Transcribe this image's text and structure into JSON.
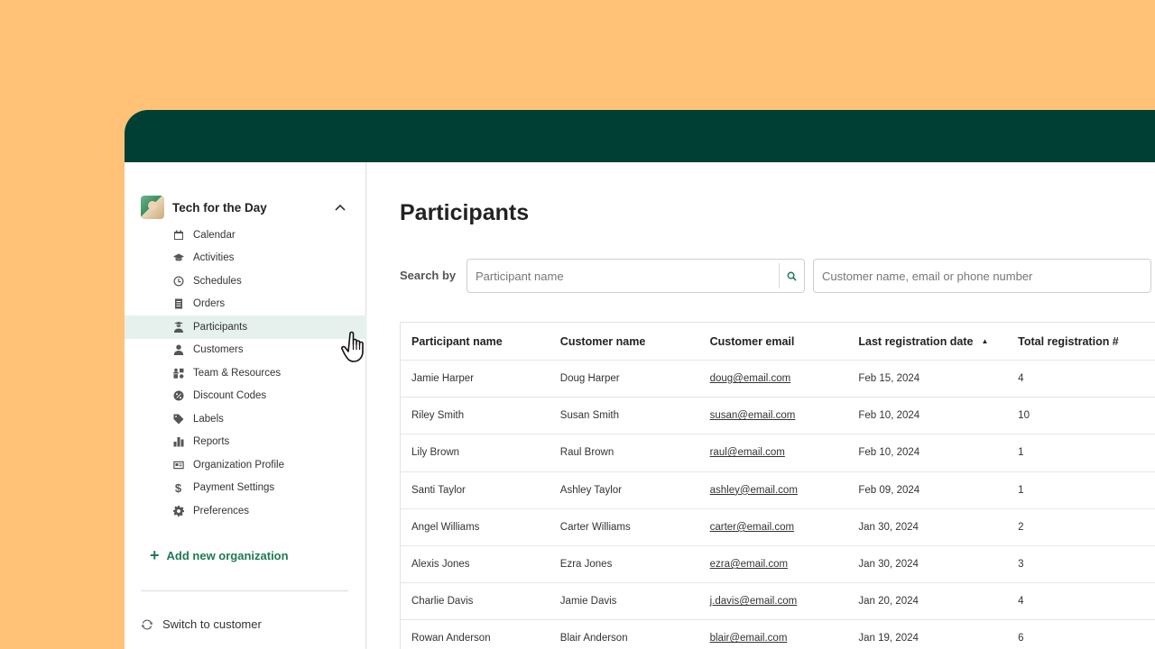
{
  "sidebar": {
    "org_name": "Tech for the Day",
    "items": [
      {
        "label": "Calendar",
        "icon": "calendar-icon"
      },
      {
        "label": "Activities",
        "icon": "graduation-cap-icon"
      },
      {
        "label": "Schedules",
        "icon": "clock-icon"
      },
      {
        "label": "Orders",
        "icon": "document-icon"
      },
      {
        "label": "Participants",
        "icon": "participant-icon",
        "active": true
      },
      {
        "label": "Customers",
        "icon": "person-icon"
      },
      {
        "label": "Team & Resources",
        "icon": "team-icon"
      },
      {
        "label": "Discount Codes",
        "icon": "discount-icon"
      },
      {
        "label": "Labels",
        "icon": "tag-icon"
      },
      {
        "label": "Reports",
        "icon": "bar-chart-icon"
      },
      {
        "label": "Organization Profile",
        "icon": "id-card-icon"
      },
      {
        "label": "Payment Settings",
        "icon": "dollar-icon"
      },
      {
        "label": "Preferences",
        "icon": "gear-icon"
      }
    ],
    "add_org": "Add new organization",
    "switch": "Switch to customer"
  },
  "main": {
    "title": "Participants",
    "search_label": "Search by",
    "search_placeholder_1": "Participant name",
    "search_placeholder_2": "Customer name, email or phone number",
    "columns": [
      "Participant name",
      "Customer name",
      "Customer email",
      "Last registration date",
      "Total registration #"
    ],
    "rows": [
      [
        "Jamie Harper",
        "Doug Harper",
        "doug@email.com",
        "Feb 15, 2024",
        "4"
      ],
      [
        "Riley Smith",
        "Susan Smith",
        "susan@email.com",
        "Feb 10, 2024",
        "10"
      ],
      [
        "Lily Brown",
        "Raul Brown",
        "raul@email.com",
        "Feb 10, 2024",
        "1"
      ],
      [
        "Santi Taylor",
        "Ashley Taylor",
        "ashley@email.com",
        "Feb 09, 2024",
        "1"
      ],
      [
        "Angel Williams",
        "Carter Williams",
        "carter@email.com",
        "Jan 30, 2024",
        "2"
      ],
      [
        "Alexis Jones",
        "Ezra Jones",
        "ezra@email.com",
        "Jan 30, 2024",
        "3"
      ],
      [
        "Charlie Davis",
        "Jamie Davis",
        "j.davis@email.com",
        "Jan 20, 2024",
        "4"
      ],
      [
        "Rowan Anderson",
        "Blair Anderson",
        "blair@email.com",
        "Jan 19, 2024",
        "6"
      ]
    ]
  },
  "colors": {
    "background": "#FFC277",
    "topbar": "#003F33",
    "accent": "#1D7A55",
    "active_nav": "#E6F0EC"
  }
}
